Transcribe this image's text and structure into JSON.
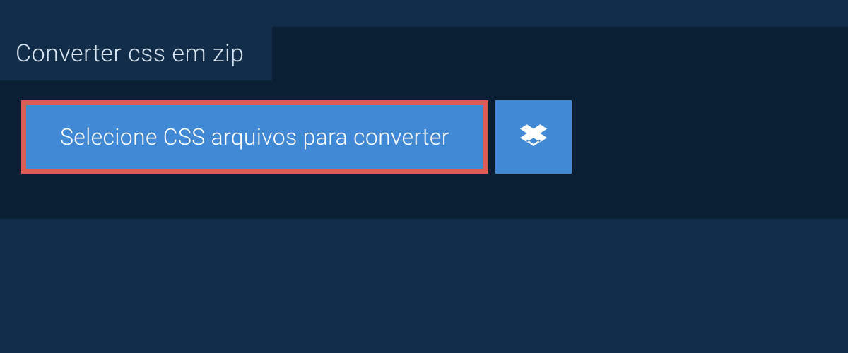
{
  "header": {
    "tab_title": "Converter css em zip"
  },
  "actions": {
    "select_button_label": "Selecione CSS arquivos para converter",
    "dropbox_icon": "dropbox-icon"
  },
  "colors": {
    "background_dark": "#0a1f33",
    "panel": "#112d4a",
    "button_primary": "#4189d4",
    "button_border_highlight": "#df5c54",
    "text_light": "#d8e4ef",
    "text_white": "#ffffff"
  }
}
